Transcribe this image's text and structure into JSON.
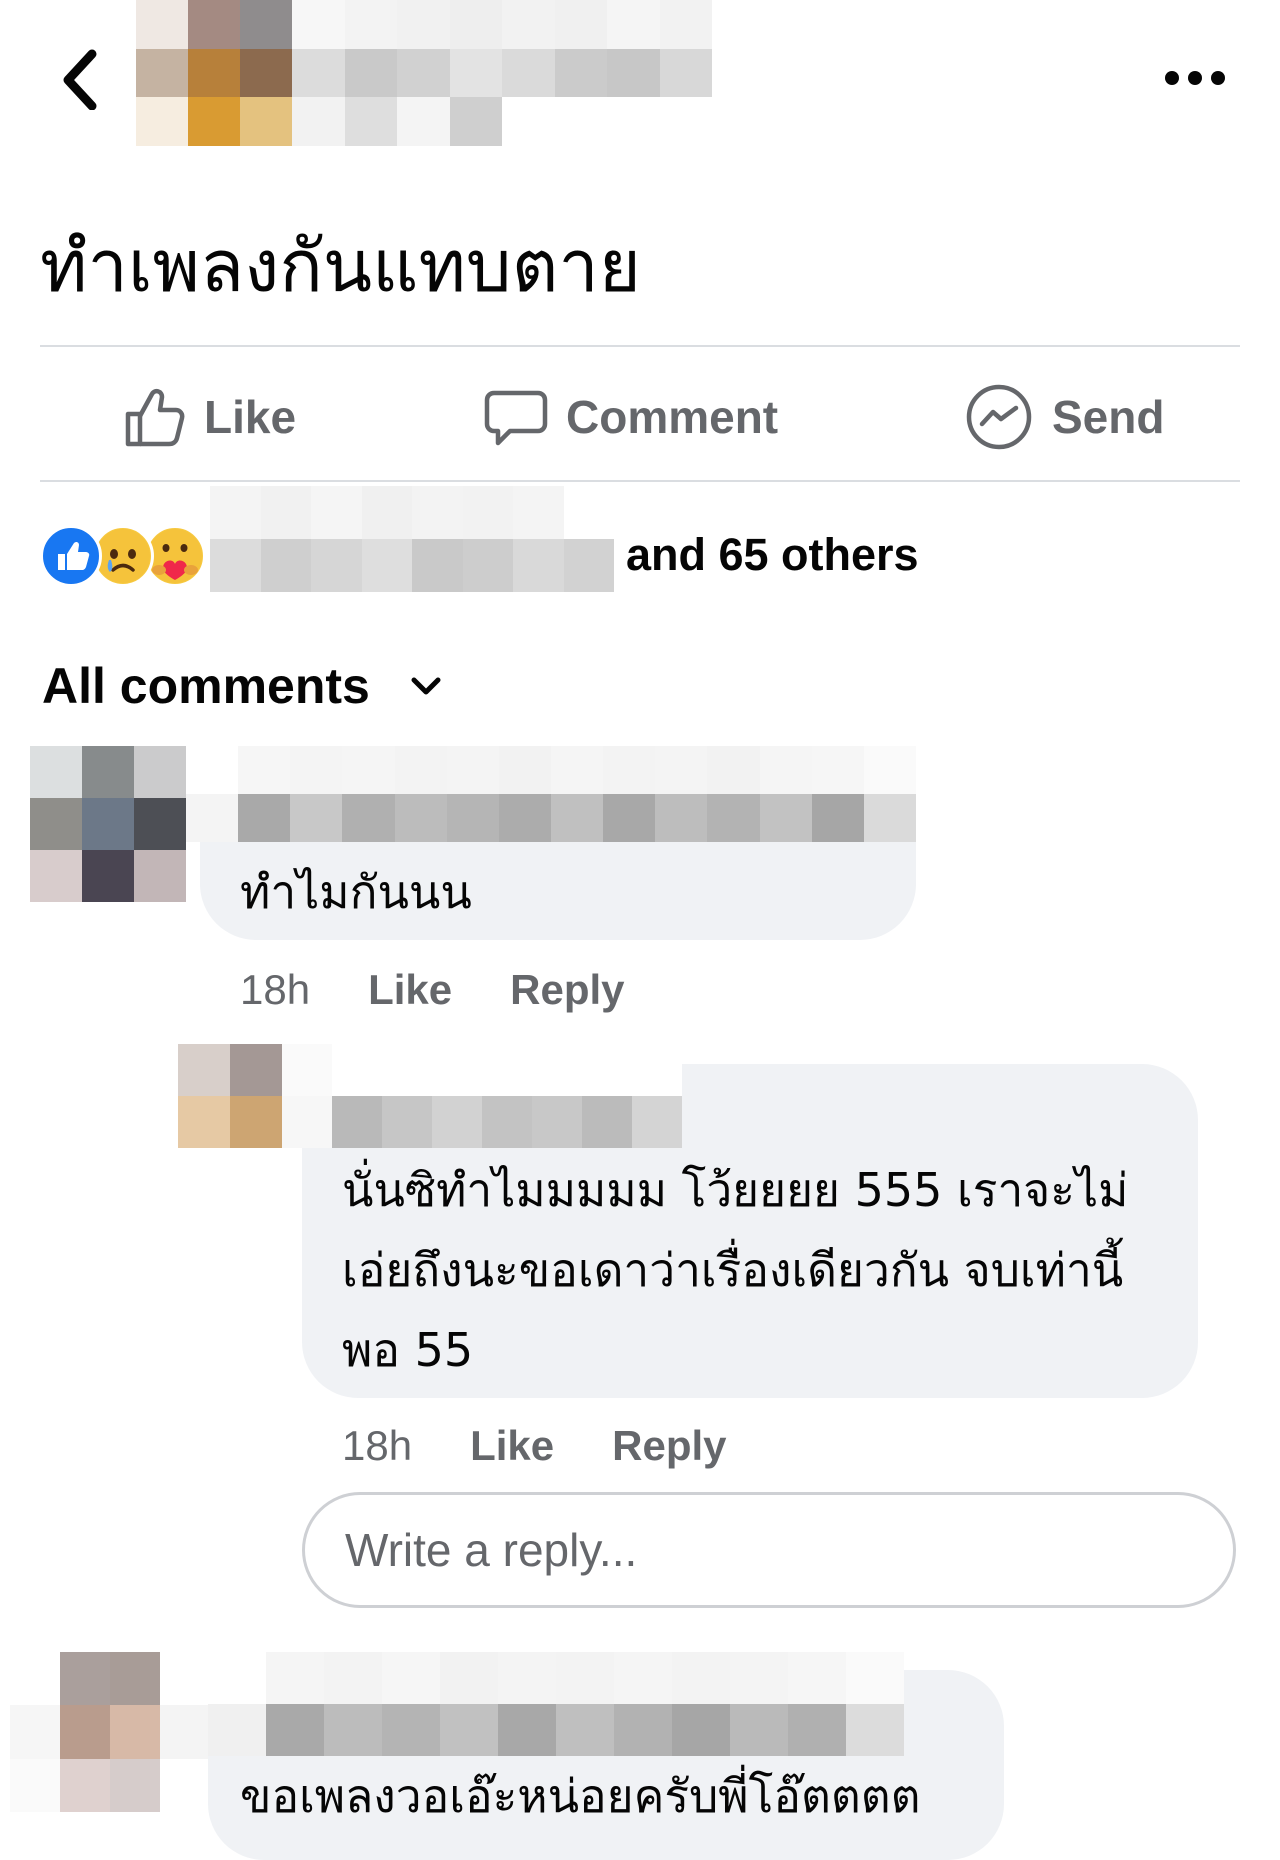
{
  "post": {
    "text": "ทำเพลงกันแทบตาย"
  },
  "actions": {
    "like_label": "Like",
    "comment_label": "Comment",
    "send_label": "Send"
  },
  "reactions": {
    "summary": "and 65 others",
    "icons": [
      "like-reaction-icon",
      "sad-reaction-icon",
      "care-reaction-icon"
    ]
  },
  "comments_header": {
    "label": "All comments"
  },
  "comments": [
    {
      "text": "ทำไมกันนน",
      "time": "18h",
      "like_label": "Like",
      "reply_label": "Reply",
      "replies": [
        {
          "text_lines": [
            "นั่นซิทำไมมมมม โว้ยยยย 555 เราจะไม่",
            "เอ่ยถึงนะขอเดาว่าเรื่องเดียวกัน จบเท่านี้",
            "พอ 55"
          ],
          "time": "18h",
          "like_label": "Like",
          "reply_label": "Reply"
        }
      ]
    },
    {
      "text": "ขอเพลงวอเอ๊ะหน่อยครับพี่โอ๊ตตตต"
    }
  ],
  "reply_box": {
    "placeholder": "Write a reply..."
  },
  "colors": {
    "secondary_text": "#65676b",
    "bubble_bg": "#f0f2f5",
    "like_blue": "#1877f2",
    "divider": "#dadde1"
  }
}
